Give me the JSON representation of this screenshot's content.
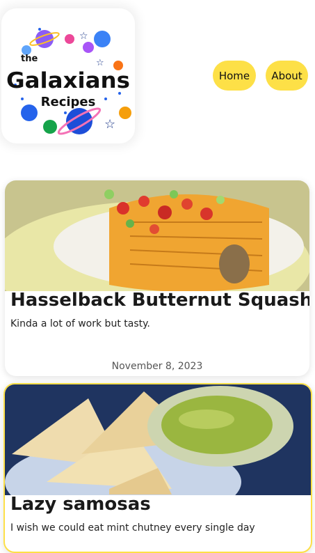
{
  "logo": {
    "line1": "the",
    "line2": "Galaxians",
    "line3": "Recipes"
  },
  "nav": {
    "items": [
      {
        "label": "Home"
      },
      {
        "label": "About"
      }
    ],
    "accent_color": "#fde047"
  },
  "posts": [
    {
      "title": "Hasselback Butternut Squash",
      "description": "Kinda a lot of work but tasty.",
      "date": "November 8, 2023"
    },
    {
      "title": "Lazy samosas",
      "description": "I wish we could eat mint chutney every single day"
    }
  ]
}
